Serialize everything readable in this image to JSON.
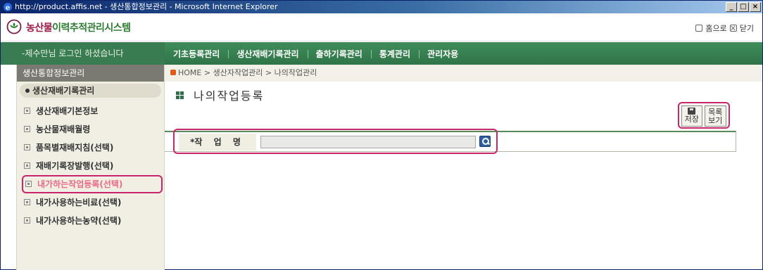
{
  "window": {
    "title": "http://product.affis.net - 생산통합정보관리 - Microsoft Internet Explorer",
    "buttons": {
      "minimize": "_",
      "maximize": "□",
      "close": "×"
    }
  },
  "header": {
    "logo_prefix": "농산물",
    "logo_suffix": "이력추적관리시스템",
    "home_label": "홈으로",
    "close_label": "닫기"
  },
  "nav": {
    "login_message": "-제수만님 로그인 하셨습니다",
    "menu": [
      "기초등록관리",
      "생산재배기록관리",
      "출하기록관리",
      "통계관리",
      "관리자용"
    ]
  },
  "sidebar": {
    "title": "생산통합정보관리",
    "section": "생산재배기록관리",
    "items": [
      {
        "label": "생산재배기본정보"
      },
      {
        "label": "농산물재배월령"
      },
      {
        "label": "품목별재배지침(선택)"
      },
      {
        "label": "재배기록장발행(선택)"
      },
      {
        "label": "내가하는작업등록(선택)",
        "active": true
      },
      {
        "label": "내가사용하는비료(선택)"
      },
      {
        "label": "내가사용하는농약(선택)"
      }
    ]
  },
  "breadcrumb": "HOME > 생산자작업관리 > 나의작업관리",
  "page_title": "나의작업등록",
  "buttons": {
    "save_label": "저장",
    "list_label_line1": "목록",
    "list_label_line2": "보기"
  },
  "form": {
    "job_name_label": "작 업 명",
    "required_mark": "*",
    "job_name_value": ""
  },
  "colors": {
    "nav_green": "#2f7448",
    "highlight": "#c8266b",
    "active_item": "#e86a8a"
  }
}
